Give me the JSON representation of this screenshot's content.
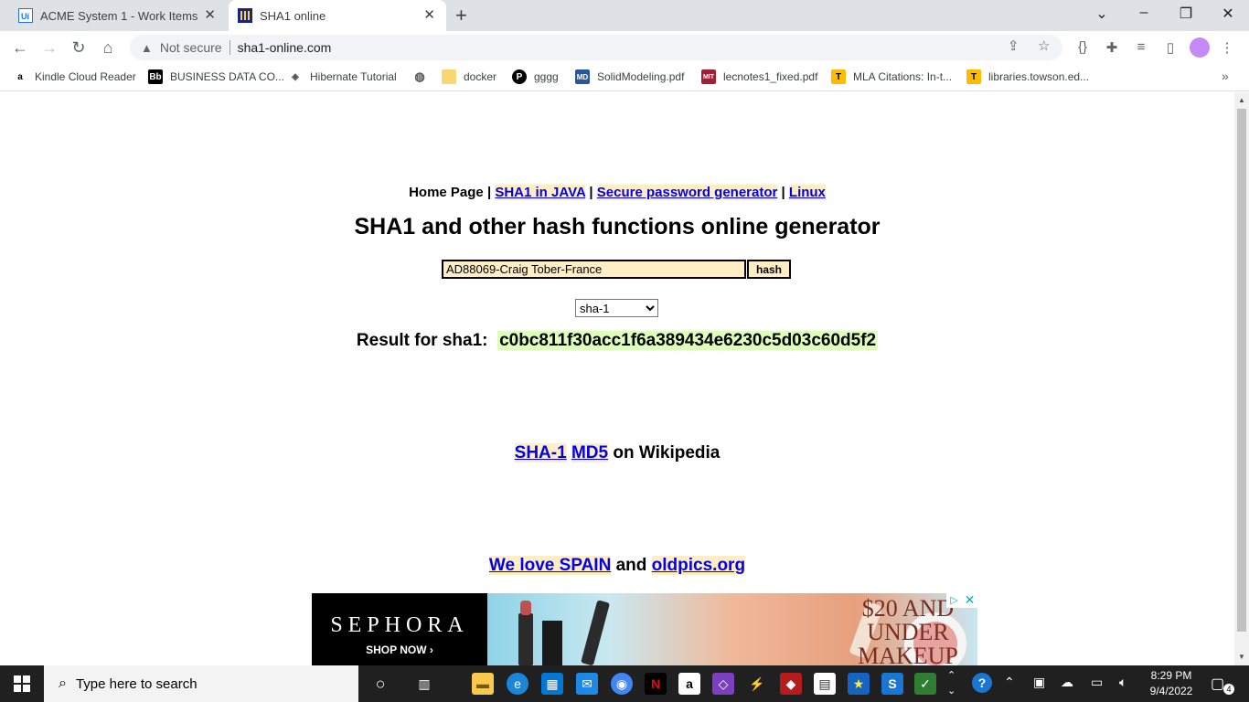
{
  "browser": {
    "tabs": [
      {
        "title": "ACME System 1 - Work Items"
      },
      {
        "title": "SHA1 online"
      }
    ],
    "address": {
      "security": "Not secure",
      "url": "sha1-online.com"
    },
    "bookmarks": [
      {
        "label": "Kindle Cloud Reader"
      },
      {
        "label": "BUSINESS DATA CO..."
      },
      {
        "label": "Hibernate Tutorial"
      },
      {
        "label": ""
      },
      {
        "label": "docker"
      },
      {
        "label": "gggg"
      },
      {
        "label": "SolidModeling.pdf"
      },
      {
        "label": "lecnotes1_fixed.pdf"
      },
      {
        "label": "MLA Citations: In-t..."
      },
      {
        "label": "libraries.towson.ed..."
      }
    ]
  },
  "page": {
    "nav": {
      "home": "Home Page",
      "sep": "|",
      "java": "SHA1 in JAVA",
      "password": "Secure password generator",
      "linux": "Linux"
    },
    "title": "SHA1 and other hash functions online generator",
    "form": {
      "input_value": "AD88069-Craig Tober-France",
      "button": "hash",
      "algorithm": "sha-1"
    },
    "result": {
      "label": "Result for sha1:",
      "hash": "c0bc811f30acc1f6a389434e6230c5d03c60d5f2"
    },
    "wiki": {
      "sha1": "SHA-1",
      "md5": "MD5",
      "suffix": "on Wikipedia"
    },
    "love": {
      "spain": "We love SPAIN",
      "and": "and",
      "oldpics": "oldpics.org"
    },
    "ad": {
      "brand": "SEPHORA",
      "cta": "SHOP NOW ›",
      "offer": "$20 AND UNDER MAKEUP"
    }
  },
  "taskbar": {
    "search_placeholder": "Type here to search",
    "time": "8:29 PM",
    "date": "9/4/2022",
    "notifications": "4"
  }
}
